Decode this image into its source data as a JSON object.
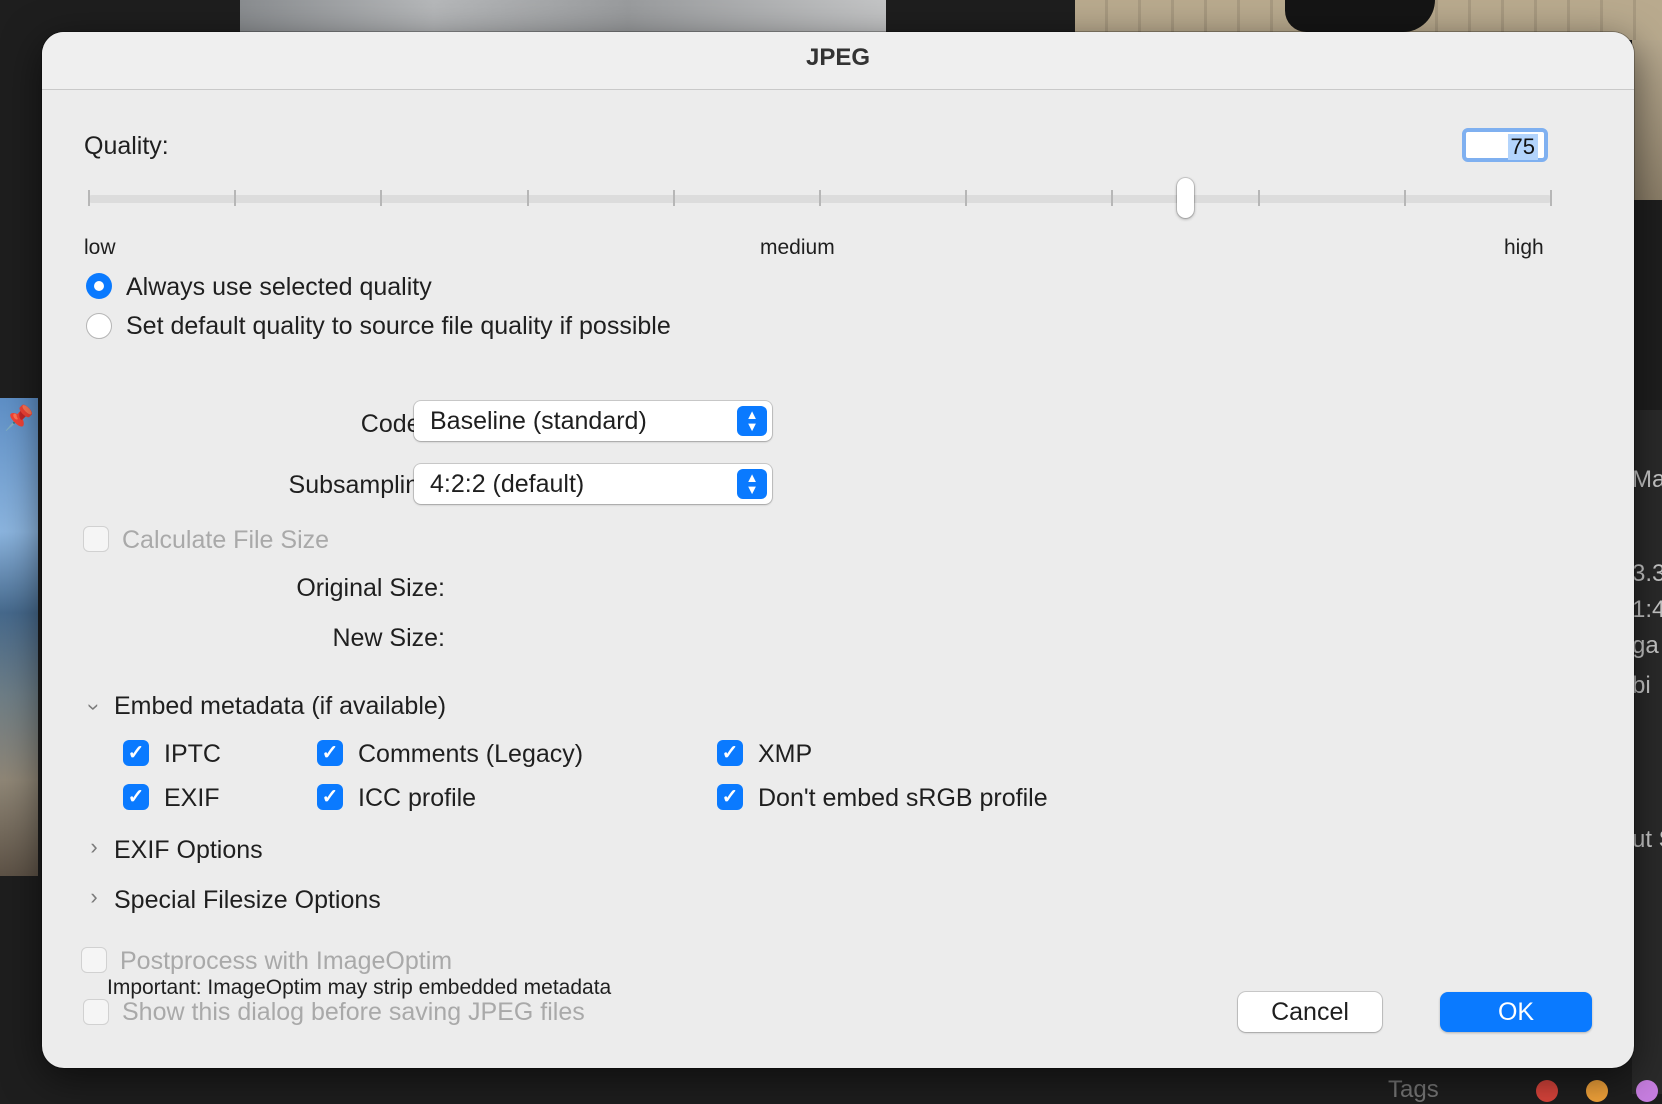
{
  "dialog": {
    "title": "JPEG",
    "quality_label": "Quality:",
    "quality_value": "75",
    "quality_slider": {
      "low_label": "low",
      "medium_label": "medium",
      "high_label": "high",
      "value": 75,
      "min": 0,
      "max": 100
    },
    "quality_mode": {
      "options": [
        {
          "label": "Always use selected quality",
          "selected": true
        },
        {
          "label": "Set default quality to source file quality if possible",
          "selected": false
        }
      ]
    },
    "codec": {
      "label": "Codec:",
      "value": "Baseline (standard)"
    },
    "subsampling": {
      "label": "Subsampling:",
      "value": "4:2:2 (default)"
    },
    "calculate_file_size": {
      "label": "Calculate File Size",
      "checked": false,
      "enabled": false
    },
    "original_size_label": "Original Size:",
    "new_size_label": "New Size:",
    "embed_metadata": {
      "label": "Embed metadata (if available)",
      "expanded": true,
      "items": [
        {
          "label": "IPTC",
          "checked": true
        },
        {
          "label": "Comments (Legacy)",
          "checked": true
        },
        {
          "label": "XMP",
          "checked": true
        },
        {
          "label": "EXIF",
          "checked": true
        },
        {
          "label": "ICC profile",
          "checked": true
        },
        {
          "label": "Don't embed sRGB profile",
          "checked": true
        }
      ]
    },
    "exif_options": {
      "label": "EXIF Options",
      "expanded": false
    },
    "special_filesize_options": {
      "label": "Special Filesize Options",
      "expanded": false
    },
    "postprocess": {
      "label": "Postprocess with ImageOptim",
      "checked": false,
      "enabled": false
    },
    "imageoptim_note": "Important: ImageOptim may strip embedded metadata",
    "show_dialog": {
      "label": "Show this dialog before saving JPEG files",
      "checked": false,
      "enabled": false
    },
    "cancel_label": "Cancel",
    "ok_label": "OK",
    "accent_color": "#0a7aff"
  },
  "background": {
    "right_text": [
      "Ma",
      "3.3",
      "1:4",
      "ga",
      "bi",
      "ut S",
      "Tags"
    ],
    "tag_dot_colors": [
      "#d9443b",
      "#f2a33a",
      "#e8c13c",
      "#c77ee0"
    ]
  }
}
